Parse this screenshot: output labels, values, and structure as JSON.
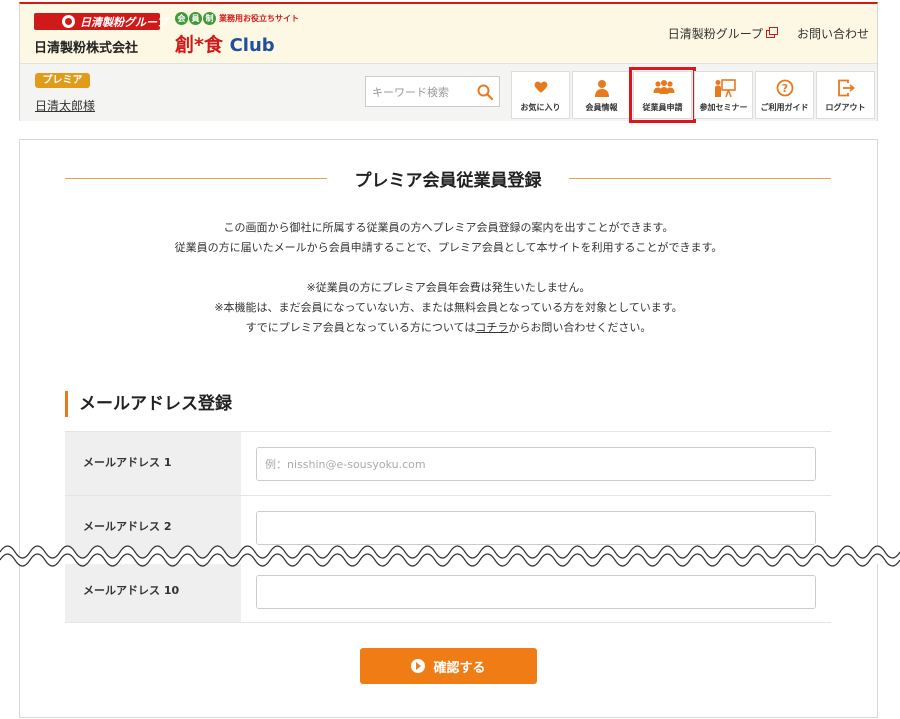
{
  "header": {
    "group_badge": "日清製粉グループ",
    "company_name": "日清製粉株式会社",
    "club_logo": {
      "member_chars": [
        "会",
        "員",
        "制"
      ],
      "tagline": "業務用お役立ちサイト",
      "name_ja": "創*食",
      "name_en": "Club"
    },
    "links": [
      {
        "label": "日清製粉グループ",
        "external": true
      },
      {
        "label": "お問い合わせ",
        "external": false
      }
    ],
    "premia_badge": "プレミア",
    "user_name": "日清太郎様",
    "search": {
      "placeholder": "キーワード検索",
      "icon": "search-icon"
    },
    "nav": [
      {
        "label": "お気に入り",
        "icon": "heart-icon"
      },
      {
        "label": "会員情報",
        "icon": "user-icon"
      },
      {
        "label": "従業員申請",
        "icon": "group-icon",
        "highlighted": true
      },
      {
        "label": "参加セミナー",
        "icon": "seminar-icon"
      },
      {
        "label": "ご利用ガイド",
        "icon": "help-icon"
      },
      {
        "label": "ログアウト",
        "icon": "logout-icon"
      }
    ],
    "accent_color": "#e87a1e",
    "brand_red": "#d01a1a",
    "highlight_color": "#e1141e"
  },
  "main": {
    "title": "プレミア会員従業員登録",
    "intro_lines": [
      "この画面から御社に所属する従業員の方へプレミア会員登録の案内を出すことができます。",
      "従業員の方に届いたメールから会員申請することで、プレミア会員として本サイトを利用することができます。"
    ],
    "notes": [
      "※従業員の方にプレミア会員年会費は発生いたしません。",
      "※本機能は、まだ会員になっていない方、または無料会員となっている方を対象としています。"
    ],
    "contact_note": {
      "before": "すでにプレミア会員となっている方については",
      "link": "コチラ",
      "after": "からお問い合わせください。"
    },
    "section_heading": "メールアドレス登録",
    "fields": [
      {
        "label": "メールアドレス 1",
        "placeholder": "例：nisshin@e-sousyoku.com",
        "value": ""
      },
      {
        "label": "メールアドレス 2",
        "placeholder": "",
        "value": ""
      },
      {
        "label": "メールアドレス 10",
        "placeholder": "",
        "value": ""
      }
    ],
    "confirm_button": "確認する"
  }
}
